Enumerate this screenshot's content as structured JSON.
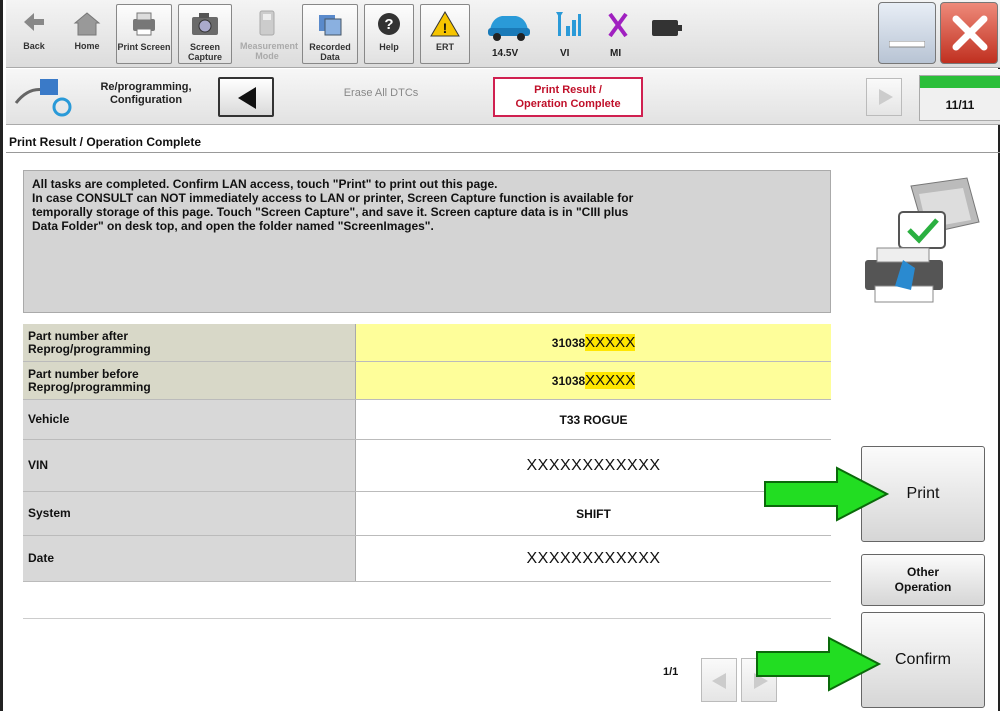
{
  "toolbar": {
    "back_label": "Back",
    "home_label": "Home",
    "print_screen_label": "Print Screen",
    "screen_capture_label_1": "Screen",
    "screen_capture_label_2": "Capture",
    "measurement_label_1": "Measurement",
    "measurement_label_2": "Mode",
    "recorded_label_1": "Recorded",
    "recorded_label_2": "Data",
    "help_label": "Help",
    "ert_label": "ERT",
    "voltage": "14.5V",
    "vi_label": "VI",
    "mi_label": "MI"
  },
  "steps": {
    "home_line1": "Re/programming,",
    "home_line2": "Configuration",
    "previous": "Erase All DTCs",
    "current_line1": "Print Result /",
    "current_line2": "Operation Complete",
    "progress_text": "11/11",
    "progress_fraction": 1.0
  },
  "page_title": "Print Result / Operation Complete",
  "message": [
    "All tasks are completed. Confirm LAN access, touch \"Print\" to print out this page.",
    "In case CONSULT can NOT immediately access to LAN or printer, Screen Capture function is available for",
    "temporally storage of this page. Touch \"Screen Capture\", and save it. Screen capture data is in \"CIII plus",
    "Data Folder\" on desk top, and open the folder named \"ScreenImages\"."
  ],
  "table": {
    "after_label_1": "Part number after",
    "after_label_2": "Reprog/programming",
    "after_value_prefix": "31038",
    "after_value_mask": "XXXXX",
    "before_label_1": "Part number before",
    "before_label_2": "Reprog/programming",
    "before_value_prefix": "31038",
    "before_value_mask": "XXXXX",
    "vehicle_label": "Vehicle",
    "vehicle_value": "T33 ROGUE",
    "vin_label": "VIN",
    "vin_value": "XXXXXXXXXXXX",
    "system_label": "System",
    "system_value": "SHIFT",
    "date_label": "Date",
    "date_value": "XXXXXXXXXXXX"
  },
  "pager": "1/1",
  "buttons": {
    "print": "Print",
    "other_1": "Other",
    "other_2": "Operation",
    "confirm": "Confirm"
  },
  "colors": {
    "highlight_row": "#fefe9a",
    "mask_highlight": "#ffe600",
    "current_step_border": "#d02050",
    "arrow": "#22dd22",
    "progress": "#2bbf3a"
  }
}
